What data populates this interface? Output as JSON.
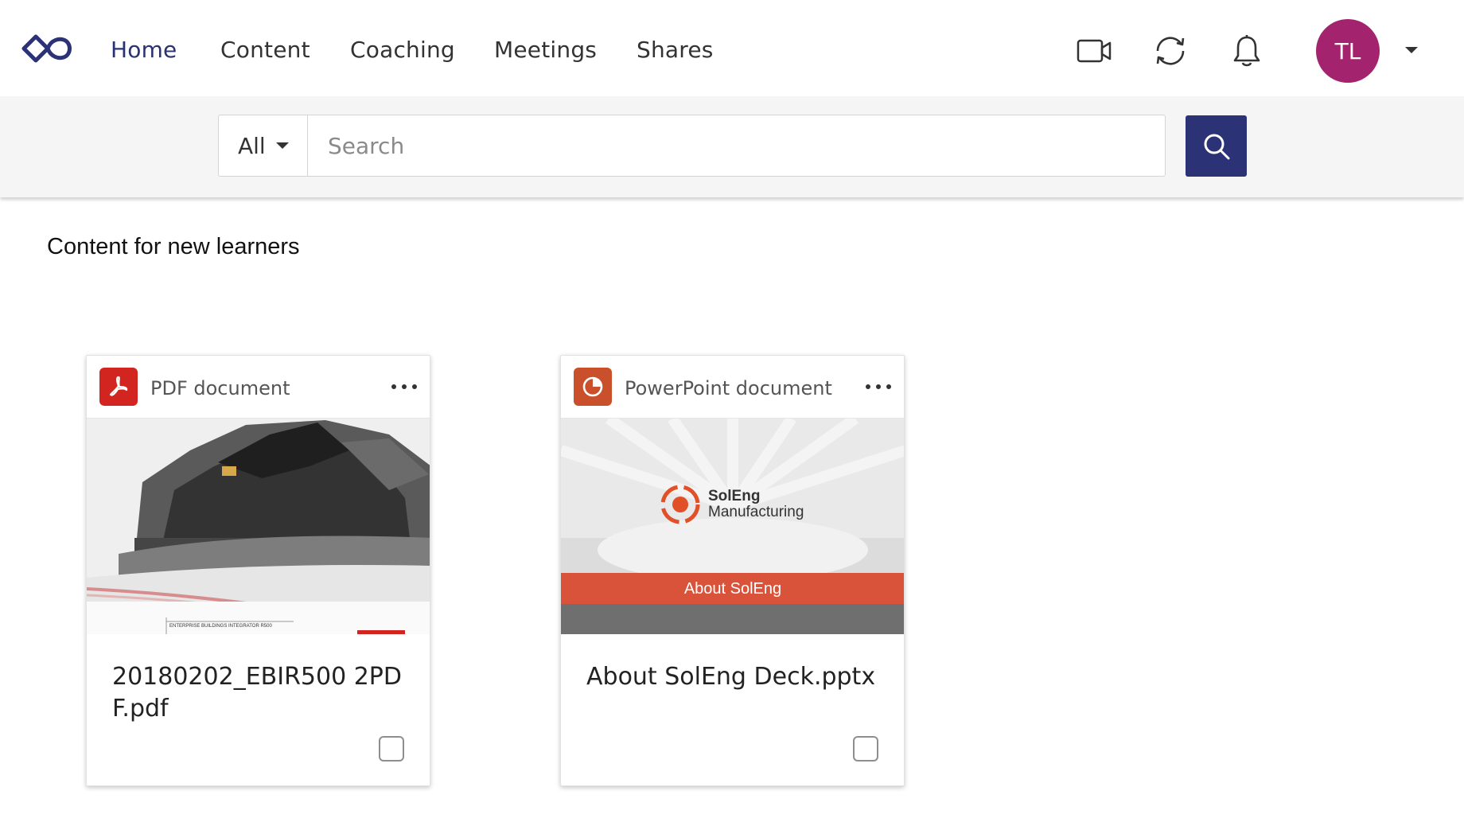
{
  "nav": {
    "items": [
      {
        "label": "Home",
        "active": true
      },
      {
        "label": "Content"
      },
      {
        "label": "Coaching"
      },
      {
        "label": "Meetings"
      },
      {
        "label": "Shares"
      }
    ],
    "icons": [
      "logo-icon",
      "video-icon",
      "sync-icon",
      "bell-icon"
    ],
    "avatar_initials": "TL",
    "avatar_color": "#a3236f"
  },
  "search": {
    "scope": "All",
    "placeholder": "Search",
    "value": ""
  },
  "section": {
    "title": "Content for new learners"
  },
  "cards": [
    {
      "type_label": "PDF document",
      "type_icon": "pdf-icon",
      "type_color": "#d3251f",
      "thumbnail_caption": "ENTERPRISE BUILDINGS INTEGRATOR R500",
      "title": "20180202_EBIR500 2PDF.pdf"
    },
    {
      "type_label": "PowerPoint document",
      "type_icon": "powerpoint-icon",
      "type_color": "#c9502a",
      "thumbnail_brand_1": "SolEng",
      "thumbnail_brand_2": "Manufacturing",
      "thumbnail_banner": "About SolEng",
      "title": "About SolEng Deck.pptx"
    }
  ],
  "colors": {
    "brand": "#2b3276",
    "search_button": "#2b3276"
  }
}
